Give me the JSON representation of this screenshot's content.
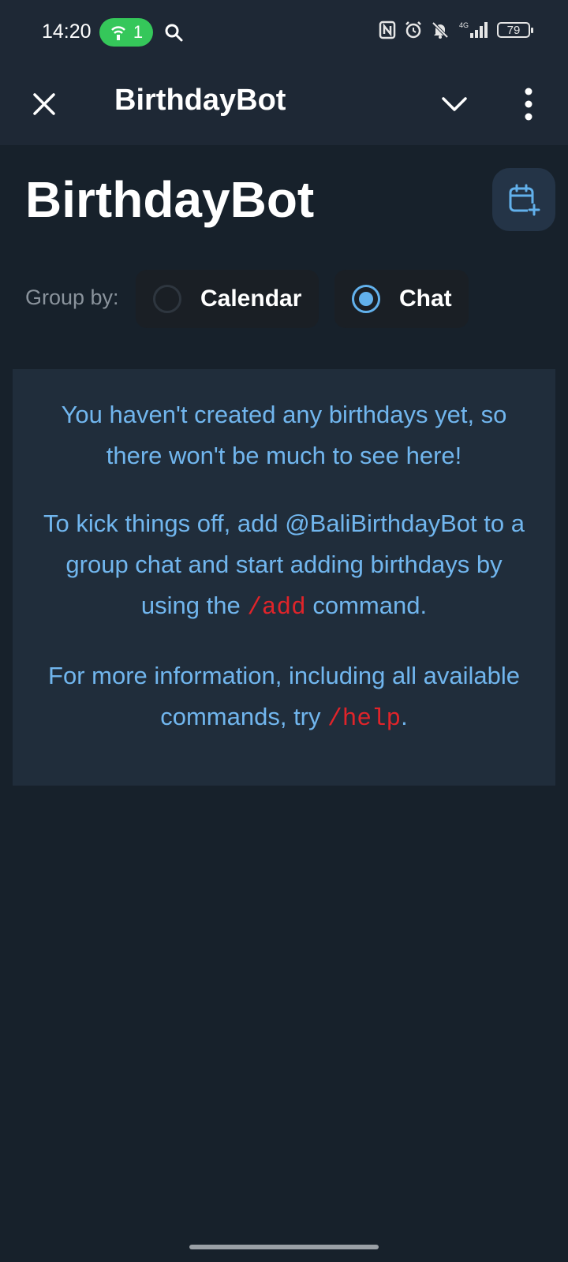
{
  "status_bar": {
    "time": "14:20",
    "hotspot_count": "1",
    "battery": "79",
    "icons": [
      "search-icon",
      "nfc-icon",
      "alarm-icon",
      "bell-off-icon",
      "signal-4g-icon",
      "battery-icon"
    ]
  },
  "app_bar": {
    "title": "BirthdayBot",
    "icons": [
      "close-icon",
      "chevron-down-icon",
      "more-vertical-icon"
    ]
  },
  "page": {
    "title": "BirthdayBot",
    "add_calendar_icon": "calendar-plus-icon",
    "group_by_label": "Group by:",
    "options": [
      {
        "label": "Calendar",
        "selected": false
      },
      {
        "label": "Chat",
        "selected": true
      }
    ]
  },
  "info": {
    "p1": "You haven't created any birthdays yet, so there won't be much to see here!",
    "p2_prefix": "To kick things off, add @BaliBirthdayBot to a group chat and start adding birthdays by using the ",
    "p2_cmd": "/add",
    "p2_suffix": " command.",
    "p3_prefix": "For more information, including all available commands, try ",
    "p3_cmd": "/help",
    "p3_suffix": "."
  },
  "colors": {
    "background": "#17212b",
    "header": "#1e2835",
    "card": "#202d3b",
    "accent_blue": "#71b6ee",
    "command_red": "#e0242a",
    "hotspot_green": "#35c75a"
  }
}
